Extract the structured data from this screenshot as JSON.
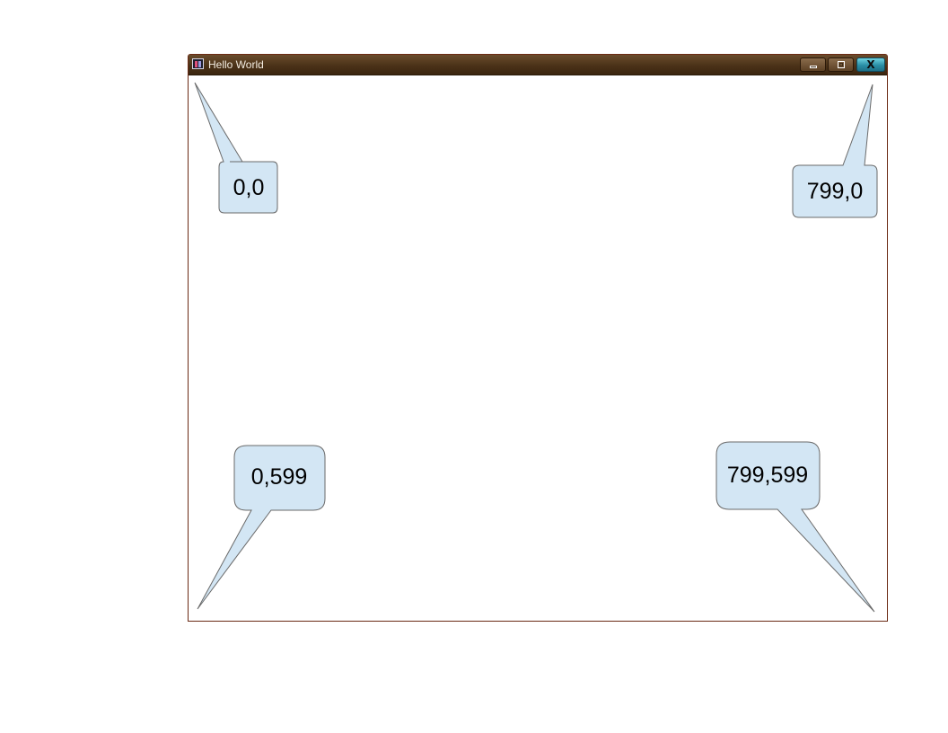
{
  "window": {
    "title": "Hello World",
    "buttons": {
      "minimize": "minimize-icon",
      "maximize": "maximize-icon",
      "close": "close-icon"
    },
    "close_glyph": "X"
  },
  "callouts": {
    "top_left": "0,0",
    "top_right": "799,0",
    "bottom_left": "0,599",
    "bottom_right": "799,599"
  },
  "colors": {
    "callout_fill": "#d3e6f4",
    "callout_stroke": "#6a6a6a",
    "window_border": "#6b2a14",
    "titlebar": "#4b3218",
    "close_button": "#2a8fa6"
  }
}
